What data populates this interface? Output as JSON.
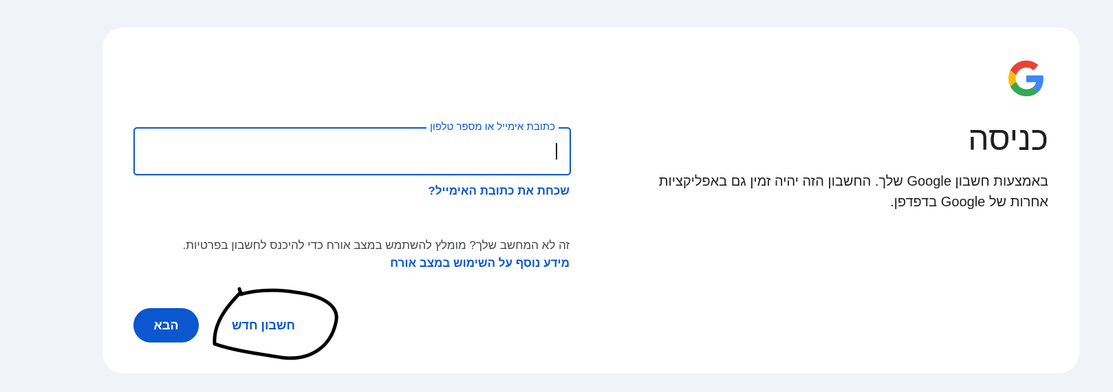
{
  "logo": {
    "icon": "google-g-icon",
    "colors": [
      "#4285F4",
      "#EA4335",
      "#FBBC05",
      "#34A853"
    ]
  },
  "heading": {
    "title": "כניסה",
    "subtitle": "באמצעות חשבון Google שלך. החשבון הזה יהיה זמין גם באפליקציות אחרות של Google בדפדפן."
  },
  "identifier": {
    "label": "כתובת אימייל או מספר טלפון",
    "value": ""
  },
  "links": {
    "forgot_email": "שכחת את כתובת האימייל?",
    "guest_info": "זה לא המחשב שלך? מומלץ להשתמש במצב אורח כדי להיכנס לחשבון בפרטיות.",
    "guest_learn_more": "מידע נוסף על השימוש במצב אורח"
  },
  "actions": {
    "next": "הבא",
    "create_account": "חשבון חדש"
  },
  "theme": {
    "accent": "#0b57d0",
    "background": "#f0f4f9"
  }
}
